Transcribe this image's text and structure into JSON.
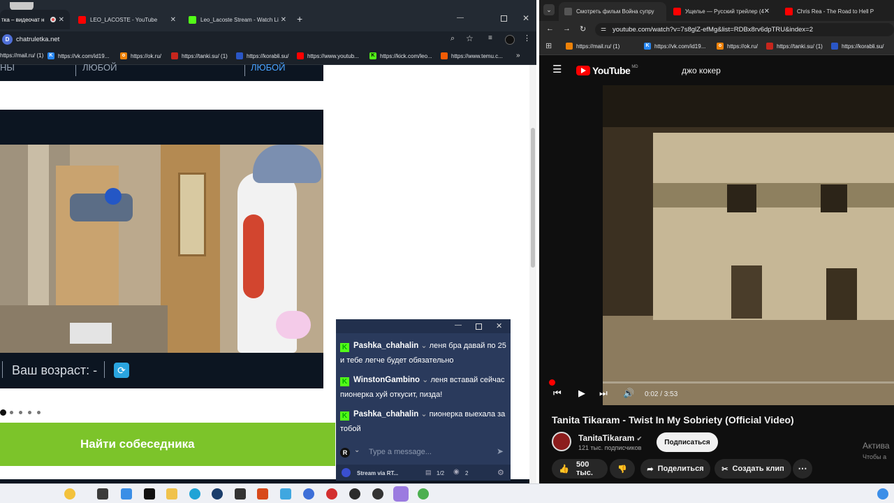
{
  "left_browser": {
    "tabs": [
      {
        "label": "тка – видеочат н",
        "active": true
      },
      {
        "label": "LEO_LACOSTE - YouTube",
        "active": false
      },
      {
        "label": "Leo_Lacoste Stream - Watch Li",
        "active": false
      }
    ],
    "url": "chatruletka.net",
    "bookmarks": [
      "https://mail.ru/ (1)",
      "https://vk.com/id19...",
      "https://ok.ru/",
      "https://tanki.su/ (1)",
      "https://korabli.su/",
      "https://www.youtub...",
      "https://kick.com/leo...",
      "https://www.temu.c..."
    ]
  },
  "page": {
    "filter_left": "НЫ",
    "filter_mid": "ЛЮБОЙ",
    "filter_right": "ЛЮБОЙ",
    "age_label": "Ваш возраст: -",
    "find_button": "Найти собеседника",
    "dots": 5
  },
  "chat": {
    "messages": [
      {
        "user": "Pashka_chahalin",
        "text": "леня бра давай по 25 и тебе легче будет обязательно"
      },
      {
        "user": "WinstonGambino",
        "text": "леня вставай сейчас пионерка хуй откусит, пизда!"
      },
      {
        "user": "Pashka_chahalin",
        "text": "пионерка выехала за тобой"
      }
    ],
    "input_placeholder": "Type a message...",
    "footer_label": "Stream via RT...",
    "page_counter": "1/2",
    "viewers": "2"
  },
  "right_browser": {
    "tabs": [
      {
        "label": "Смотреть фильм Война супру",
        "active": true
      },
      {
        "label": "Ущелье — Русский трейлер (4",
        "active": false
      },
      {
        "label": "Chris Rea - The Road to Hell P",
        "active": false
      }
    ],
    "url": "youtube.com/watch?v=7s8glZ-efMg&list=RDBx8rv6dpTRU&index=2",
    "bookmarks": [
      "https://mail.ru/ (1)",
      "https://vk.com/id19...",
      "https://ok.ru/",
      "https://tanki.su/ (1)",
      "https://korabli.su/"
    ]
  },
  "youtube": {
    "logo": "YouTube",
    "logo_suffix": "MD",
    "search_query": "джо кокер",
    "time": "0:02 / 3:53",
    "progress_fraction": 0.009,
    "title": "Tanita Tikaram - Twist In My Sobriety (Official Video)",
    "channel": "TanitaTikaram",
    "subscribers": "121 тыс. подписчиков",
    "subscribe": "Подписаться",
    "likes": "500 тыс.",
    "share": "Поделиться",
    "clip": "Создать клип",
    "activate_line1": "Актива",
    "activate_line2": "Чтобы а"
  },
  "colors": {
    "youtube_red": "#ff0000",
    "find_green": "#7cc42a",
    "kick_green": "#53fc18",
    "chat_bg": "#2a3a5c"
  }
}
